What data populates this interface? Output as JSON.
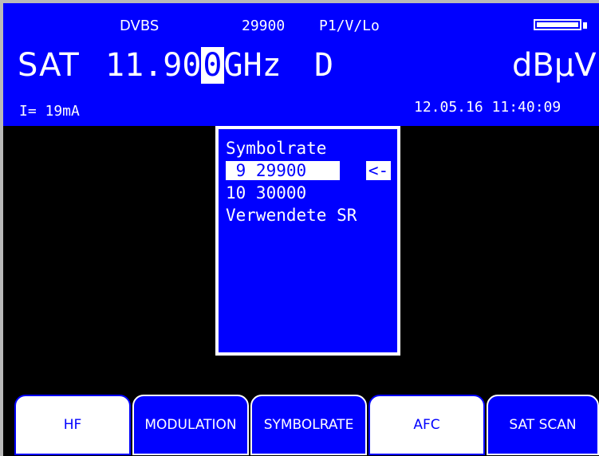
{
  "header": {
    "mode": "DVBS",
    "symbolrate_value": "29900",
    "polarization": "P1/V/Lo",
    "battery_icon": "battery-icon",
    "band_label": "SAT",
    "frequency_prefix": "11.90",
    "frequency_cursor_digit": "0",
    "frequency_unit": "GHz",
    "frequency_flag": "D",
    "level_unit": "dBµV",
    "current_display": "I= 19mA",
    "datetime": "12.05.16 11:40:09",
    "colors": {
      "header_bg": "#0000ff",
      "text": "#ffffff",
      "screen_bg": "#000000"
    }
  },
  "menu": {
    "title": "Symbolrate",
    "items": [
      {
        "label": " 9 29900",
        "selected": true,
        "marker": "<-"
      },
      {
        "label": "10 30000",
        "selected": false
      },
      {
        "label": "Verwendete SR",
        "selected": false
      }
    ]
  },
  "softkeys": [
    {
      "label": "HF",
      "style": "white"
    },
    {
      "label": "MODULATION",
      "style": "blue"
    },
    {
      "label": "SYMBOLRATE",
      "style": "blue"
    },
    {
      "label": "AFC",
      "style": "white"
    },
    {
      "label": "SAT SCAN",
      "style": "blue"
    }
  ]
}
